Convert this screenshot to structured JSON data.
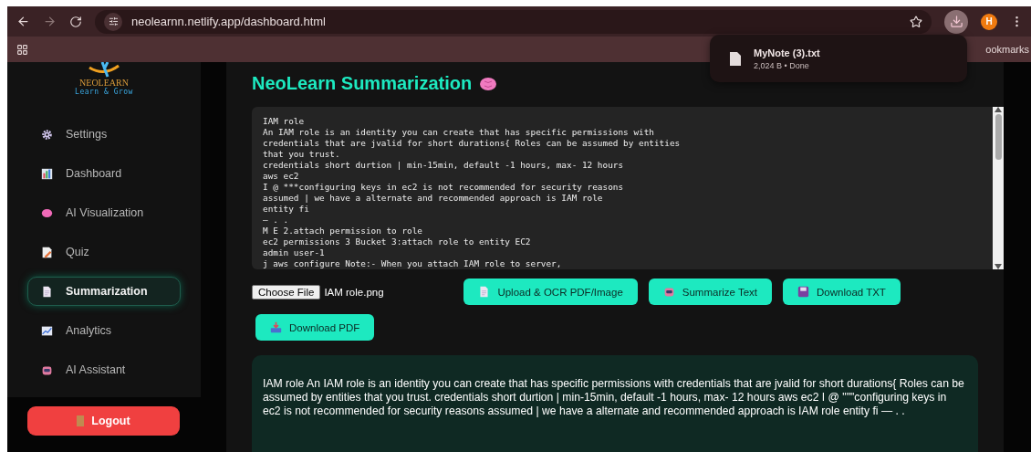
{
  "browser": {
    "url": "neolearnn.netlify.app/dashboard.html",
    "profile_initial": "H",
    "bookmarks_label": "ookmarks"
  },
  "download_popup": {
    "file_name": "MyNote (3).txt",
    "status": "2,024 B • Done"
  },
  "sidebar": {
    "brand": "NEOLEARN",
    "tagline": "Learn & Grow",
    "items": [
      {
        "label": "Settings",
        "kind": "gear",
        "selected": false
      },
      {
        "label": "Dashboard",
        "kind": "chart",
        "selected": false
      },
      {
        "label": "AI Visualization",
        "kind": "brain",
        "selected": false
      },
      {
        "label": "Quiz",
        "kind": "memo",
        "selected": false
      },
      {
        "label": "Summarization",
        "kind": "page",
        "selected": true
      },
      {
        "label": "Analytics",
        "kind": "trend",
        "selected": false
      },
      {
        "label": "AI Assistant",
        "kind": "robot",
        "selected": false
      }
    ],
    "logout": "Logout"
  },
  "main": {
    "title": "NeoLearn Summarization",
    "input_lines": [
      "IAM role",
      "An IAM role is an identity you can create that has specific permissions with",
      "credentials that are jvalid for short durations{ Roles can be assumed by entities",
      "that you trust.",
      "credentials short durtion | min-15min, default -1 hours, max- 12 hours",
      "aws ec2",
      "I @ ***configuring keys in ec2 is not recommended for security reasons",
      "assumed | we have a alternate and recommended approach is IAM role",
      "entity fi",
      "— . .",
      "M E 2.attach permission to role",
      "ec2 permissions 3 Bucket 3:attach role to entity EC2",
      "admin user-1",
      "j aws configure Note:- When you attach IAM role to server,"
    ],
    "file_button": "Choose File",
    "file_name": "IAM role.png",
    "actions": [
      {
        "label": "Upload & OCR PDF/Image",
        "kind": "page"
      },
      {
        "label": "Summarize Text",
        "kind": "robot"
      },
      {
        "label": "Download TXT",
        "kind": "disk"
      },
      {
        "label": "Download PDF",
        "kind": "inbox"
      }
    ],
    "summary": "IAM role An IAM role is an identity you can create that has specific permissions with credentials that are jvalid for short durations{ Roles can be assumed by entities that you trust. credentials short durtion | min-15min, default -1 hours, max- 12 hours aws ec2 I @ \"\"\"configuring keys in ec2 is not recommended for security reasons assumed | we have a alternate and recommended approach is IAM role entity fi — . ."
  }
}
